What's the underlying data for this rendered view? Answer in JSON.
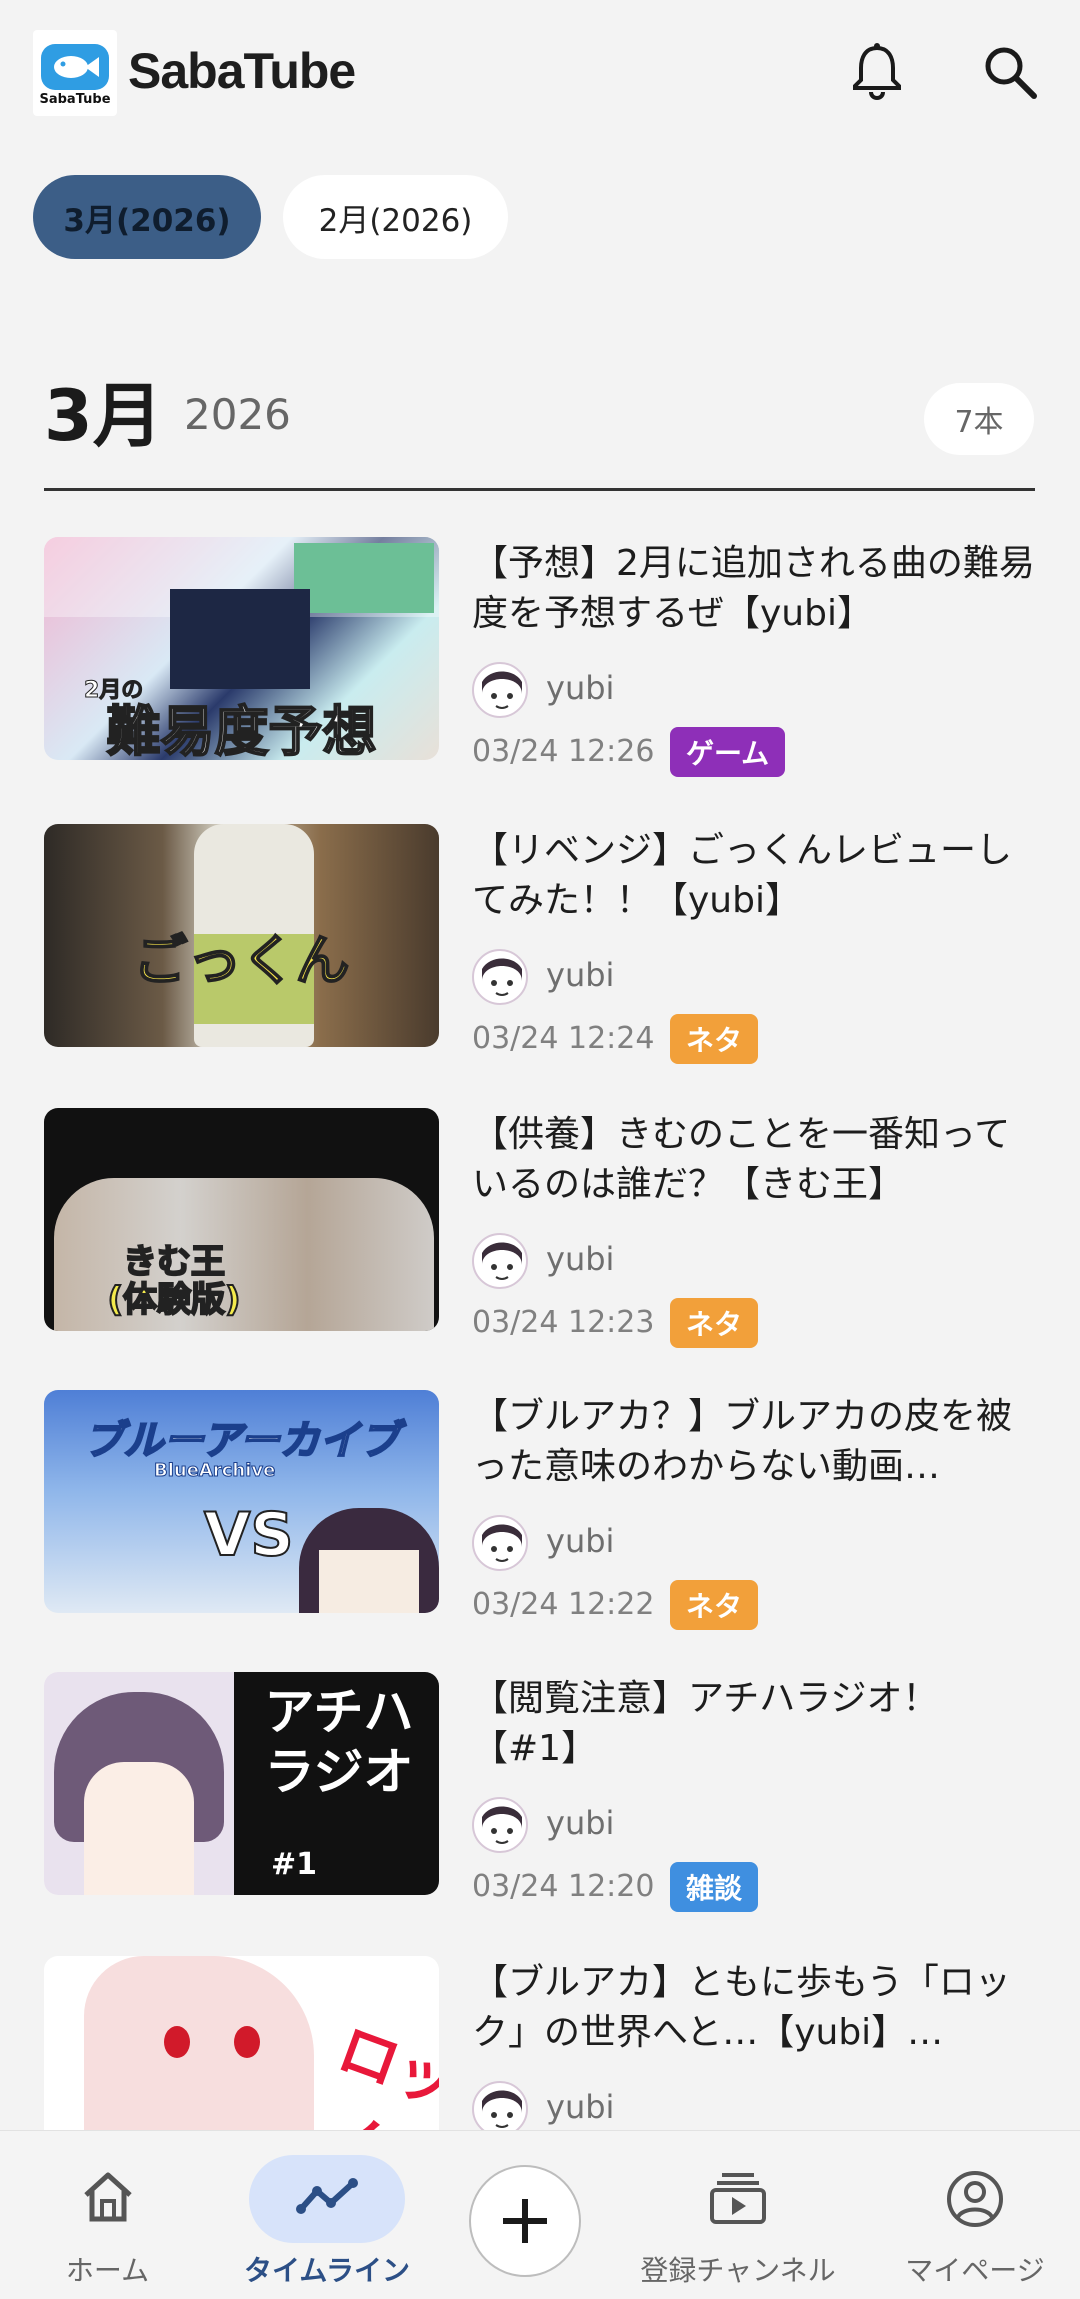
{
  "app": {
    "title": "SabaTube",
    "logo_text": "SabaTube"
  },
  "header": {
    "icons": [
      "bell-icon",
      "search-icon"
    ]
  },
  "month_chips": [
    {
      "label": "3月(2026)",
      "selected": true
    },
    {
      "label": "2月(2026)",
      "selected": false
    }
  ],
  "section": {
    "month": "3月",
    "year": "2026",
    "count": "7本"
  },
  "videos": [
    {
      "title": "【予想】2月に追加される曲の難易度を予想するぜ【yubi】",
      "channel": "yubi",
      "date": "03/24 12:26",
      "tag": "ゲーム",
      "tag_color": "#8e2fb8",
      "thumb_text": "2月の\n難易度予想"
    },
    {
      "title": "【リベンジ】ごっくんレビューしてみた！！【yubi】",
      "channel": "yubi",
      "date": "03/24 12:24",
      "tag": "ネタ",
      "tag_color": "#f2a03a",
      "thumb_text": "ごっくん"
    },
    {
      "title": "【供養】きむのことを一番知っているのは誰だ？【きむ王】",
      "channel": "yubi",
      "date": "03/24 12:23",
      "tag": "ネタ",
      "tag_color": "#f2a03a",
      "thumb_text": "きむ王\n(体験版)"
    },
    {
      "title": "【ブルアカ？】ブルアカの皮を被った意味のわからない動画…",
      "channel": "yubi",
      "date": "03/24 12:22",
      "tag": "ネタ",
      "tag_color": "#f2a03a",
      "thumb_text": "ブルーアーカイブ\nBlueArchive\nVS 俺"
    },
    {
      "title": "【閲覧注意】アチハラジオ！【#1】",
      "channel": "yubi",
      "date": "03/24 12:20",
      "tag": "雑談",
      "tag_color": "#3f8fe0",
      "thumb_text": "アチハ\nラジオ\n#1"
    },
    {
      "title": "【ブルアカ】ともに歩もう「ロック」の世界へと…【yubi】…",
      "channel": "yubi",
      "date": "",
      "tag": "",
      "tag_color": "",
      "thumb_text": "ロック"
    }
  ],
  "bottom_nav": [
    {
      "label": "ホーム",
      "icon": "home-icon",
      "active": false
    },
    {
      "label": "タイムライン",
      "icon": "timeline-icon",
      "active": true
    },
    {
      "label": "",
      "icon": "plus-icon",
      "active": false
    },
    {
      "label": "登録チャンネル",
      "icon": "subscriptions-icon",
      "active": false
    },
    {
      "label": "マイページ",
      "icon": "account-icon",
      "active": false
    }
  ],
  "colors": {
    "accent": "#3c5e87",
    "active_nav": "#2c4f86",
    "background": "#f3f3f3"
  }
}
